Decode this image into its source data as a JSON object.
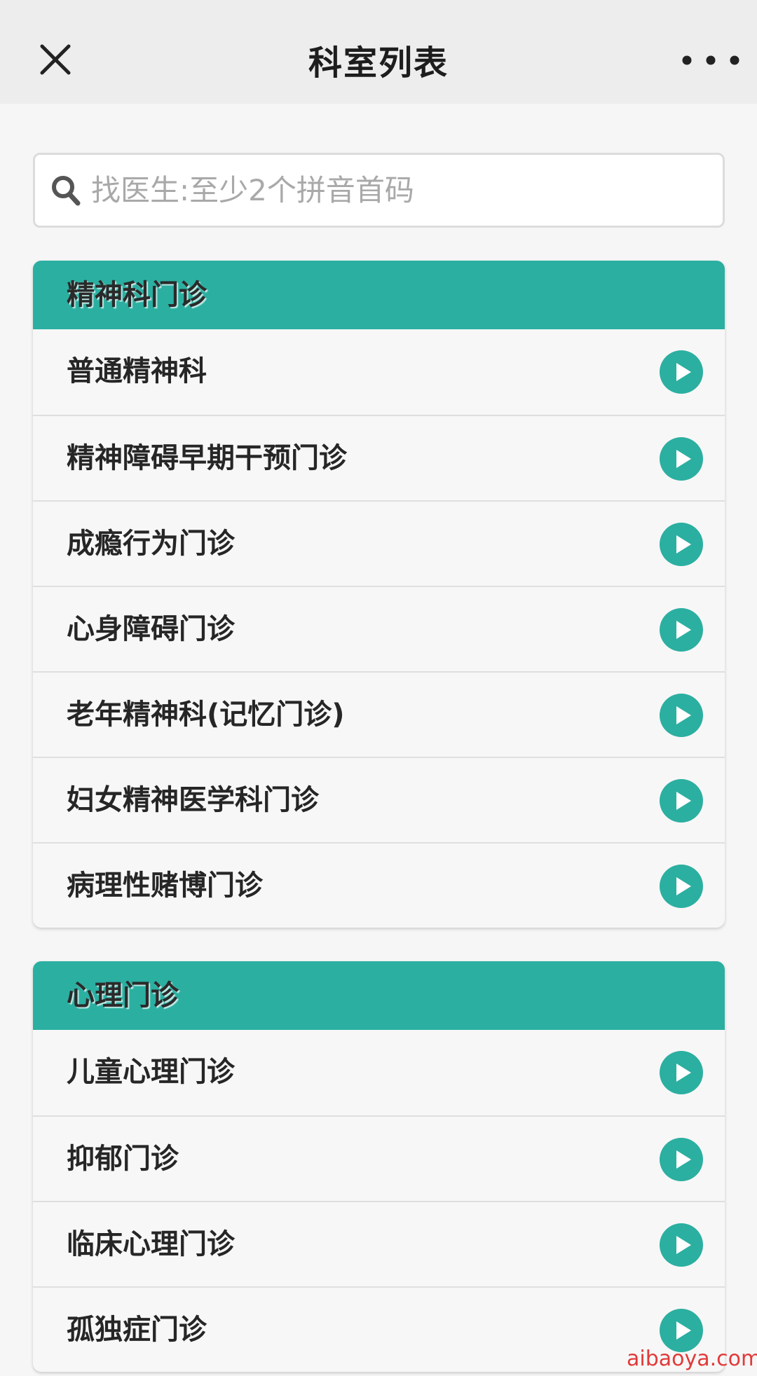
{
  "header": {
    "title": "科室列表"
  },
  "search": {
    "placeholder": "找医生:至少2个拼音首码"
  },
  "sections": [
    {
      "title": "精神科门诊",
      "items": [
        "普通精神科",
        "精神障碍早期干预门诊",
        "成瘾行为门诊",
        "心身障碍门诊",
        "老年精神科(记忆门诊)",
        "妇女精神医学科门诊",
        "病理性赌博门诊"
      ]
    },
    {
      "title": "心理门诊",
      "items": [
        "儿童心理门诊",
        "抑郁门诊",
        "临床心理门诊",
        "孤独症门诊"
      ]
    }
  ],
  "watermark": "aibaoya.com",
  "colors": {
    "accent": "#2bafa1",
    "topbar": "#ededed",
    "watermark": "#e23a3a"
  },
  "icons": {
    "close": "close-icon",
    "more": "more-dots-icon",
    "search": "search-icon",
    "item_arrow": "play-circle-icon"
  }
}
